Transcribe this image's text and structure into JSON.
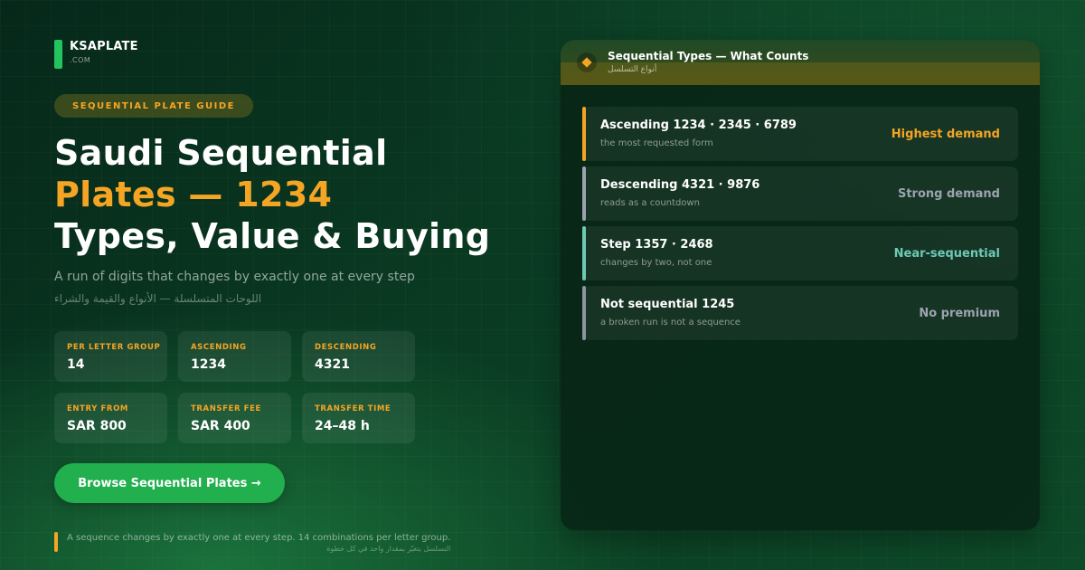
{
  "brand": {
    "name": "KSAPLATE",
    "sub": ".COM"
  },
  "guide_pill": "SEQUENTIAL PLATE GUIDE",
  "title": {
    "line1": "Saudi Sequential",
    "line2": "Plates — 1234",
    "line3": "Types, Value & Buying"
  },
  "subtitle": "A run of digits that changes by exactly one at every step",
  "subtitle_ar": "اللوحات المتسلسلة — الأنواع والقيمة والشراء",
  "stats": [
    {
      "label": "PER LETTER GROUP",
      "value": "14"
    },
    {
      "label": "ASCENDING",
      "value": "1234"
    },
    {
      "label": "DESCENDING",
      "value": "4321"
    },
    {
      "label": "ENTRY FROM",
      "value": "SAR 800"
    },
    {
      "label": "TRANSFER FEE",
      "value": "SAR 400"
    },
    {
      "label": "TRANSFER TIME",
      "value": "24–48 h"
    }
  ],
  "cta": "Browse Sequential Plates →",
  "footnote": {
    "text": "A sequence changes by exactly one at every step. 14 combinations per letter group.",
    "ar": "التسلسل يتغيّر بمقدار واحد في كل خطوة"
  },
  "card": {
    "title": "Sequential Types — What Counts",
    "subtitle": "أنواع التسلسل",
    "rows": [
      {
        "name": "Ascending 1234 · 2345 · 6789",
        "desc": "the most requested form",
        "tag": "Highest demand",
        "color": "#f5a524"
      },
      {
        "name": "Descending 4321 · 9876",
        "desc": "reads as a countdown",
        "tag": "Strong demand",
        "color": "#9ca3af"
      },
      {
        "name": "Step 1357 · 2468",
        "desc": "changes by two, not one",
        "tag": "Near-sequential",
        "color": "#6ec9b4"
      },
      {
        "name": "Not sequential 1245",
        "desc": "a broken run is not a sequence",
        "tag": "No premium",
        "color": "#8b95a1"
      }
    ]
  },
  "colors": {
    "accent": "#f5a524",
    "brand_green": "#22c55e",
    "cta_green": "#22b04f"
  },
  "icons": {
    "card_header": "diamond-icon"
  }
}
